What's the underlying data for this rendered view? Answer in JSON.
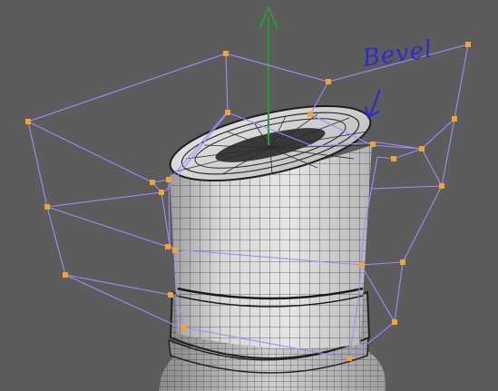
{
  "viewport": {
    "background": "#5c5c5c",
    "lattice_color": "#9d8bff",
    "control_point_color": "#f2a431",
    "axis_color": "#2e9a2e",
    "mesh_face_color": "#d4d4d4",
    "mesh_wire_color": "#2e2e2e"
  },
  "annotation": {
    "text": "Bevel",
    "color": "#2b2bcf"
  }
}
